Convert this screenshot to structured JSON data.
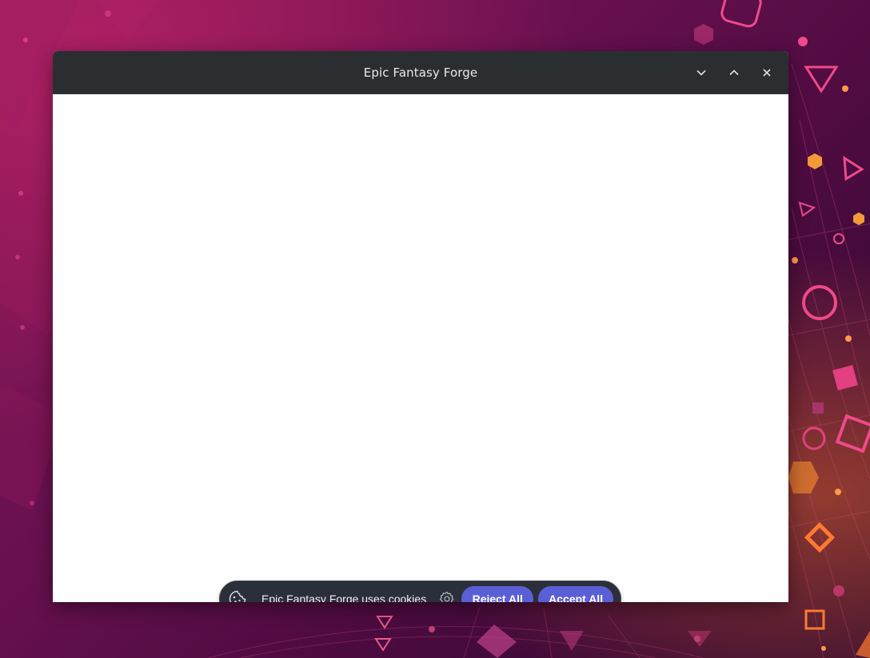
{
  "window": {
    "title": "Epic Fantasy Forge",
    "controls": {
      "minimize_icon": "chevron-down-icon",
      "maximize_icon": "chevron-up-icon",
      "close_icon": "close-icon"
    }
  },
  "cookie_banner": {
    "icon": "cookie-icon",
    "message": "Epic Fantasy Forge uses cookies",
    "settings_icon": "gear-icon",
    "reject_label": "Reject All",
    "accept_label": "Accept All",
    "button_color": "#5b5fd6",
    "background_color": "#2b2f3a"
  },
  "colors": {
    "titlebar": "#2b2e31",
    "wallpaper_primary": "#6b1150",
    "wallpaper_accent": "#ff7a30"
  }
}
